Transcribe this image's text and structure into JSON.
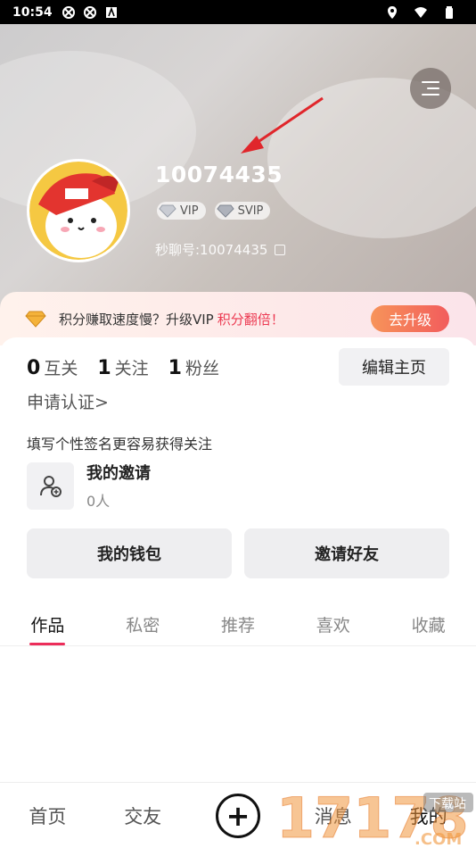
{
  "status_bar": {
    "time": "10:54",
    "left_icons": [
      "sync-icon",
      "sync-icon",
      "a-icon"
    ],
    "right_icons": [
      "location-icon",
      "wifi-icon",
      "battery-icon"
    ]
  },
  "header": {
    "menu_icon": "menu-icon"
  },
  "profile": {
    "username": "10074435",
    "badges": [
      {
        "label": "VIP",
        "icon": "diamond-icon"
      },
      {
        "label": "SVIP",
        "icon": "diamond-icon"
      }
    ],
    "account_id": "秒聊号:10074435"
  },
  "promo": {
    "text": "积分赚取速度慢？升级VIP",
    "highlight": "积分翻倍！",
    "button": "去升级",
    "accent": "#ec3a52"
  },
  "stats": [
    {
      "num": "0",
      "label": "互关"
    },
    {
      "num": "1",
      "label": "关注"
    },
    {
      "num": "1",
      "label": "粉丝"
    }
  ],
  "edit_button": "编辑主页",
  "verify_link": "申请认证>",
  "bio_placeholder": "填写个性签名更容易获得关注",
  "invite": {
    "title": "我的邀请",
    "count": "0人"
  },
  "buttons": {
    "wallet": "我的钱包",
    "invite_friends": "邀请好友"
  },
  "tabs": [
    {
      "label": "作品",
      "active": true
    },
    {
      "label": "私密",
      "active": false
    },
    {
      "label": "推荐",
      "active": false
    },
    {
      "label": "喜欢",
      "active": false
    },
    {
      "label": "收藏",
      "active": false
    }
  ],
  "bottom_nav": {
    "home": "首页",
    "friends": "交友",
    "plus": "+",
    "messages": "消息",
    "me": "我的"
  },
  "colors": {
    "tab_indicator": "#ec2d5a",
    "upgrade_button": "#f25c5c"
  },
  "watermark": {
    "logo_text": "17178",
    "domain": ".COM",
    "tag": "下载站"
  }
}
